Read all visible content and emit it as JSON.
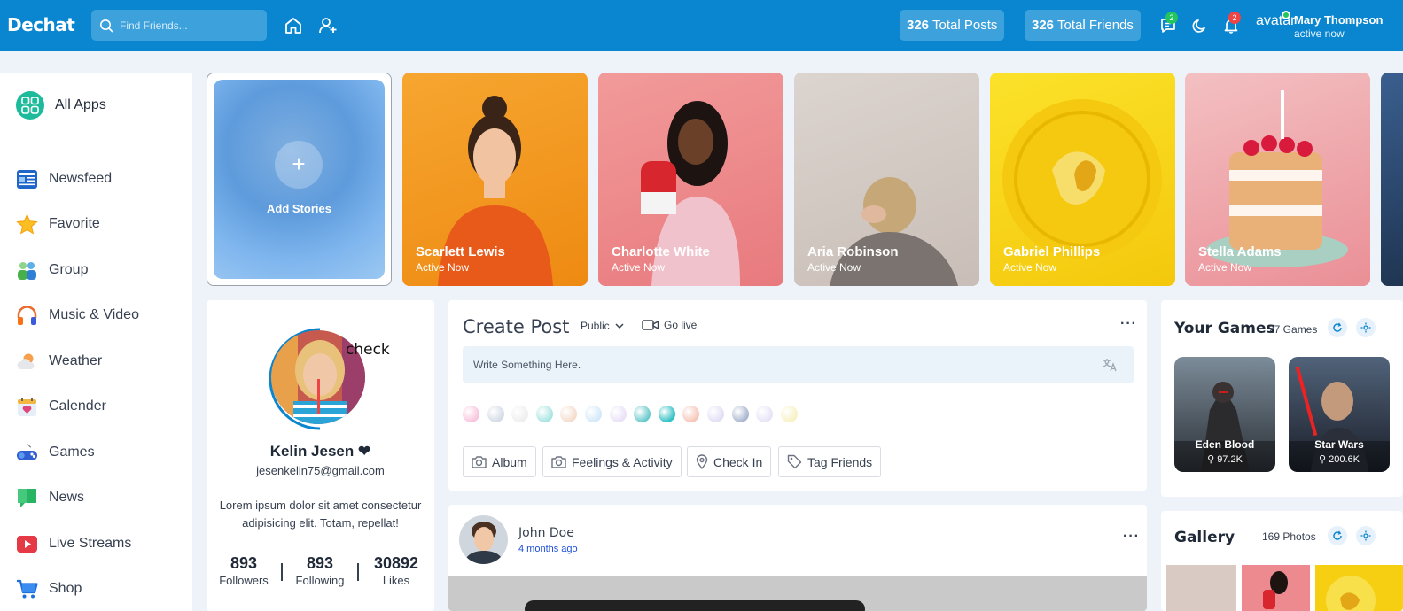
{
  "app": {
    "brand": "Dechat"
  },
  "search": {
    "placeholder": "Find Friends..."
  },
  "header": {
    "posts_count": "326",
    "posts_label": "Total Posts",
    "friends_count": "326",
    "friends_label": "Total Friends",
    "messages_badge": "2",
    "notifications_badge": "2",
    "avatar_alt": "avatar",
    "user_name": "Mary Thompson",
    "user_status": "active now"
  },
  "sidebar": {
    "all_apps": "All Apps",
    "items": [
      {
        "label": "Newsfeed",
        "icon": "newsfeed-icon"
      },
      {
        "label": "Favorite",
        "icon": "star-icon"
      },
      {
        "label": "Group",
        "icon": "group-icon"
      },
      {
        "label": "Music & Video",
        "icon": "headphones-icon"
      },
      {
        "label": "Weather",
        "icon": "weather-icon"
      },
      {
        "label": "Calender",
        "icon": "calendar-icon"
      },
      {
        "label": "Games",
        "icon": "gamepad-icon"
      },
      {
        "label": "News",
        "icon": "news-icon"
      },
      {
        "label": "Live Streams",
        "icon": "play-icon"
      },
      {
        "label": "Shop",
        "icon": "cart-icon"
      }
    ]
  },
  "stories": {
    "add_label": "Add Stories",
    "items": [
      {
        "name": "Scarlett Lewis",
        "status": "Active Now",
        "color": "#f29a1c"
      },
      {
        "name": "Charlotte White",
        "status": "Active Now",
        "color": "#ee8a8a"
      },
      {
        "name": "Aria Robinson",
        "status": "Active Now",
        "color": "#d8cfc9"
      },
      {
        "name": "Gabriel Phillips",
        "status": "Active Now",
        "color": "#f7d21a"
      },
      {
        "name": "Stella Adams",
        "status": "Active Now",
        "color": "#ee8a94"
      }
    ]
  },
  "profile": {
    "badge_text": "check",
    "name": "Kelin Jesen ❤",
    "email": "jesenkelin75@gmail.com",
    "bio": "Lorem ipsum dolor sit amet consectetur adipisicing elit. Totam, repellat!",
    "stats": [
      {
        "value": "893",
        "label": "Followers"
      },
      {
        "value": "893",
        "label": "Following"
      },
      {
        "value": "30892",
        "label": "Likes"
      }
    ]
  },
  "create_post": {
    "title": "Create Post",
    "privacy": "Public",
    "go_live": "Go live",
    "placeholder": "Write Something Here.",
    "bg_colors": [
      "#f9c3dc",
      "#d3dbe6",
      "#eeeeee",
      "#a6e4e1",
      "#f3dccb",
      "#d2e8fa",
      "#e9e1f7",
      "#66c9cc",
      "#2ebfc4",
      "#f6c5b6",
      "#e2def4",
      "#a8b5cf",
      "#e7e3f6",
      "#f7f1c3"
    ],
    "buttons": [
      "Album",
      "Feelings & Activity",
      "Check In",
      "Tag Friends"
    ]
  },
  "post": {
    "author": "John Doe",
    "time": "4 months ago"
  },
  "games": {
    "title": "Your Games",
    "count": "27 Games",
    "items": [
      {
        "name": "Eden Blood",
        "players": "97.2K"
      },
      {
        "name": "Star Wars",
        "players": "200.6K"
      }
    ]
  },
  "gallery": {
    "title": "Gallery",
    "count": "169 Photos"
  }
}
